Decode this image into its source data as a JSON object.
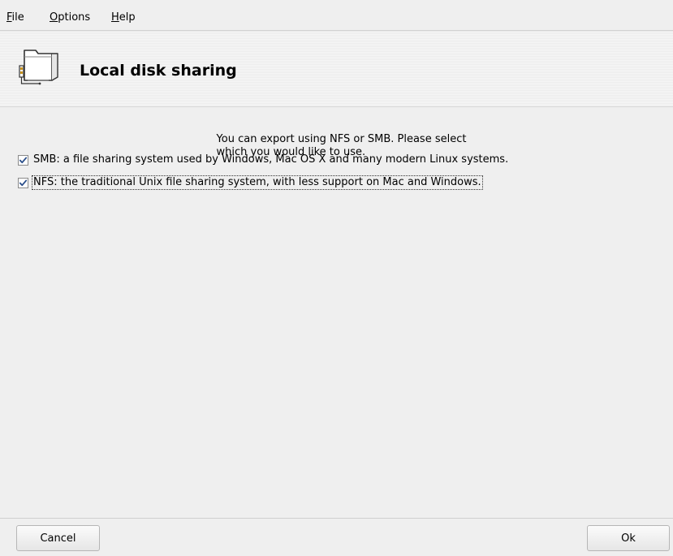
{
  "menubar": {
    "items": [
      {
        "label": "File",
        "mnemonic": "F",
        "rest": "ile"
      },
      {
        "label": "Options",
        "mnemonic": "O",
        "rest": "ptions"
      },
      {
        "label": "Help",
        "mnemonic": "H",
        "rest": "elp"
      }
    ]
  },
  "banner": {
    "title": "Local disk sharing",
    "icon": "folder-sharing-icon"
  },
  "main": {
    "intro_text": "You can export using NFS or SMB. Please select\nwhich you would like to use.",
    "options": [
      {
        "label": "SMB: a file sharing system used by Windows, Mac OS X and many modern Linux systems.",
        "checked": true,
        "focused": false
      },
      {
        "label": "NFS: the traditional Unix file sharing system, with less support on Mac and Windows.",
        "checked": true,
        "focused": true
      }
    ]
  },
  "buttons": {
    "cancel_label": "Cancel",
    "ok_label": "Ok"
  },
  "colors": {
    "window_bg": "#efefef",
    "checkmark": "#2a4e8a",
    "separator": "#d0d0d0"
  }
}
